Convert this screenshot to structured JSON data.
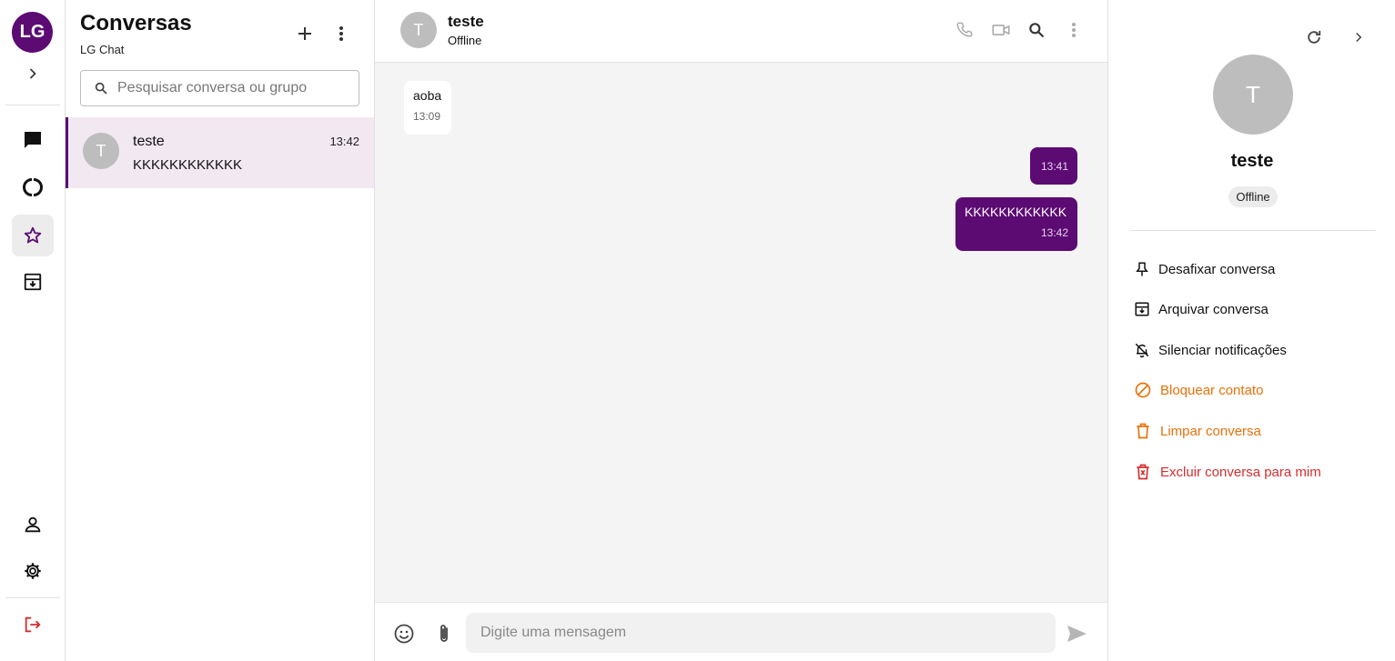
{
  "rail": {
    "logo": "LG",
    "items": [
      {
        "icon": "expand-chevron-icon"
      },
      {
        "icon": "chat-icon"
      },
      {
        "icon": "status-icon"
      },
      {
        "icon": "star-icon"
      },
      {
        "icon": "archive-icon"
      }
    ],
    "bottom": [
      {
        "icon": "profile-icon"
      },
      {
        "icon": "settings-icon"
      },
      {
        "icon": "logout-icon"
      }
    ],
    "accent": "#5c0b73",
    "logout_color": "#d32f2f"
  },
  "list": {
    "title": "Conversas",
    "subtitle": "LG Chat",
    "search_placeholder": "Pesquisar conversa ou grupo",
    "conversations": [
      {
        "initial": "T",
        "name": "teste",
        "time": "13:42",
        "last_message": "KKKKKKKKKKKK"
      }
    ]
  },
  "chat": {
    "contact": {
      "initial": "T",
      "name": "teste",
      "status": "Offline"
    },
    "messages": [
      {
        "direction": "in",
        "text": "aoba",
        "time": "13:09"
      },
      {
        "direction": "out",
        "text": "",
        "time": "13:41"
      },
      {
        "direction": "out",
        "text": "KKKKKKKKKKKK",
        "time": "13:42"
      }
    ],
    "input_placeholder": "Digite uma mensagem"
  },
  "info": {
    "initial": "T",
    "name": "teste",
    "status": "Offline",
    "actions": [
      {
        "label": "Desafixar conversa",
        "icon": "unpin-icon",
        "tone": "normal"
      },
      {
        "label": "Arquivar conversa",
        "icon": "archive-icon",
        "tone": "normal"
      },
      {
        "label": "Silenciar notificações",
        "icon": "bell-off-icon",
        "tone": "normal"
      },
      {
        "label": "Bloquear contato",
        "icon": "block-icon",
        "tone": "warning"
      },
      {
        "label": "Limpar conversa",
        "icon": "trash-icon",
        "tone": "warning"
      },
      {
        "label": "Excluir conversa para mim",
        "icon": "delete-forever-icon",
        "tone": "danger"
      }
    ],
    "warning_color": "#e8710a",
    "danger_color": "#d32f2f"
  }
}
